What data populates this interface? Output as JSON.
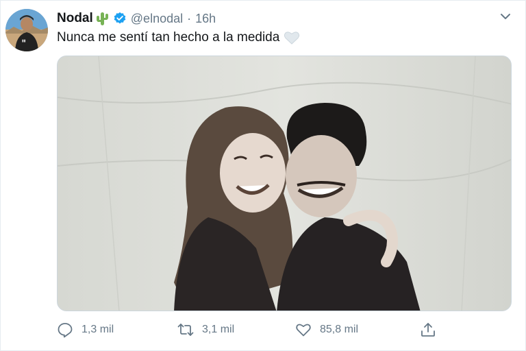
{
  "tweet": {
    "author_name": "Nodal",
    "author_handle": "@elnodal",
    "separator": "·",
    "time": "16h",
    "text": "Nunca me sentí tan hecho a la medida",
    "replies": "1,3 mil",
    "retweets": "3,1 mil",
    "likes": "85,8 mil"
  },
  "icons": {
    "avatar": "avatar",
    "name_emoji": "cactus-icon",
    "verified": "verified-badge-icon",
    "menu": "chevron-down-icon",
    "text_emoji": "white-heart-icon",
    "reply": "reply-icon",
    "retweet": "retweet-icon",
    "like": "heart-icon",
    "share": "share-icon"
  },
  "colors": {
    "verified": "#1da1f2",
    "secondary_text": "#657786",
    "primary_text": "#14171a"
  }
}
